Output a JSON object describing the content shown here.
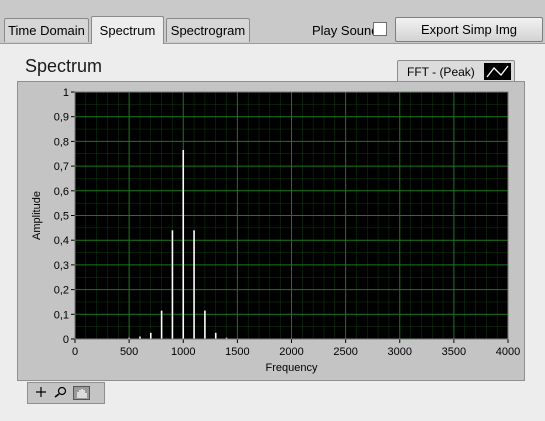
{
  "tabs": [
    {
      "label": "Time Domain",
      "active": false
    },
    {
      "label": "Spectrum",
      "active": true
    },
    {
      "label": "Spectrogram",
      "active": false
    }
  ],
  "play_sound": {
    "label": "Play Sound",
    "checked": false
  },
  "export_button": {
    "label": "Export Simp Img"
  },
  "panel_title": "Spectrum",
  "legend": {
    "label": "FFT - (Peak)"
  },
  "toolbar": {
    "tools": [
      "cursor-tool",
      "zoom-tool",
      "pan-tool"
    ],
    "selected": "pan-tool"
  },
  "colors": {
    "plot_bg": "#000000",
    "grid": "#1a7a1a",
    "trace": "#ffffff"
  },
  "chart_data": {
    "type": "line",
    "xlabel": "Frequency",
    "ylabel": "Amplitude",
    "xlim": [
      0,
      4000
    ],
    "ylim": [
      0,
      1
    ],
    "x_ticks": [
      "0",
      "500",
      "1000",
      "1500",
      "2000",
      "2500",
      "3000",
      "3500",
      "4000"
    ],
    "y_ticks": [
      "0",
      "0,1",
      "0,2",
      "0,3",
      "0,4",
      "0,5",
      "0,6",
      "0,7",
      "0,8",
      "0,9",
      "1"
    ],
    "grid": true,
    "series": [
      {
        "x": [
          500,
          600,
          700,
          800,
          900,
          1000,
          1100,
          1200,
          1300,
          1400
        ],
        "y": [
          0.005,
          0.01,
          0.025,
          0.115,
          0.44,
          0.765,
          0.44,
          0.115,
          0.025,
          0.005
        ]
      }
    ]
  }
}
